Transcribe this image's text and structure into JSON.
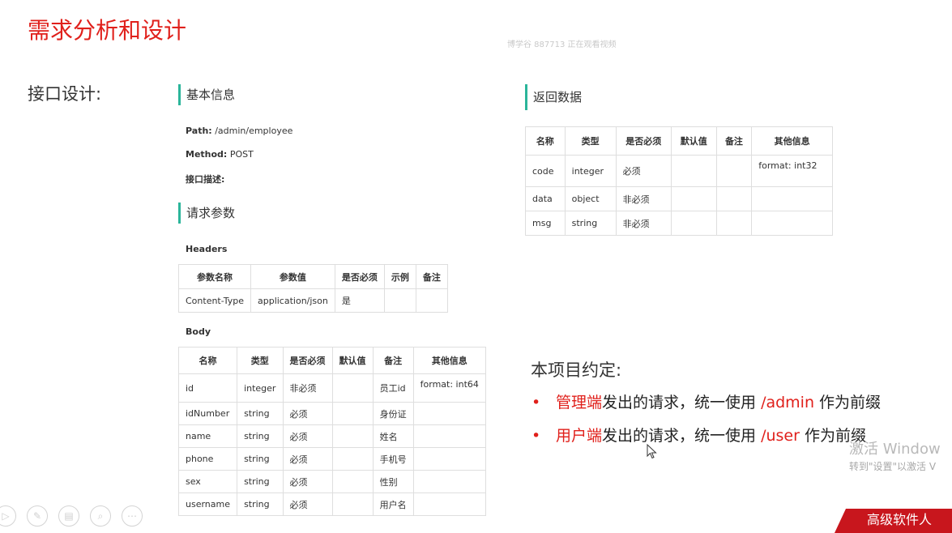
{
  "slide": {
    "title": "需求分析和设计",
    "watermark": "博学谷 887713 正在观看视频",
    "interface_label": "接口设计:"
  },
  "basic_info": {
    "heading": "基本信息",
    "path_label": "Path:",
    "path_value": "/admin/employee",
    "method_label": "Method:",
    "method_value": "POST",
    "desc_label": "接口描述:"
  },
  "request_params": {
    "heading": "请求参数",
    "headers_label": "Headers",
    "headers_columns": [
      "参数名称",
      "参数值",
      "是否必须",
      "示例",
      "备注"
    ],
    "headers_rows": [
      [
        "Content-Type",
        "application/json",
        "是",
        "",
        ""
      ]
    ],
    "body_label": "Body",
    "body_columns": [
      "名称",
      "类型",
      "是否必须",
      "默认值",
      "备注",
      "其他信息"
    ],
    "body_rows": [
      [
        "id",
        "integer",
        "非必须",
        "",
        "员工id",
        "format: int64"
      ],
      [
        "idNumber",
        "string",
        "必须",
        "",
        "身份证",
        ""
      ],
      [
        "name",
        "string",
        "必须",
        "",
        "姓名",
        ""
      ],
      [
        "phone",
        "string",
        "必须",
        "",
        "手机号",
        ""
      ],
      [
        "sex",
        "string",
        "必须",
        "",
        "性别",
        ""
      ],
      [
        "username",
        "string",
        "必须",
        "",
        "用户名",
        ""
      ]
    ]
  },
  "response": {
    "heading": "返回数据",
    "columns": [
      "名称",
      "类型",
      "是否必须",
      "默认值",
      "备注",
      "其他信息"
    ],
    "rows": [
      [
        "code",
        "integer",
        "必须",
        "",
        "",
        "format: int32"
      ],
      [
        "data",
        "object",
        "非必须",
        "",
        "",
        ""
      ],
      [
        "msg",
        "string",
        "非必须",
        "",
        "",
        ""
      ]
    ]
  },
  "convention": {
    "title": "本项目约定:",
    "bullet_char": "•",
    "items": [
      {
        "highlight": "管理端",
        "text_mid": "发出的请求，统一使用 ",
        "path": "/admin",
        "text_end": " 作为前缀"
      },
      {
        "highlight": "用户端",
        "text_mid": "发出的请求，统一使用 ",
        "path": "/user",
        "text_end": " 作为前缀"
      }
    ]
  },
  "overlay": {
    "activate_title": "激活 Window",
    "activate_sub": "转到\"设置\"以激活 V",
    "brand_text": "高级软件人"
  },
  "icons": {
    "play": "play-icon",
    "pen": "pen-icon",
    "pages": "pages-icon",
    "zoom": "zoom-icon",
    "more": "more-icon"
  },
  "colors": {
    "accent_red": "#e0201b",
    "section_bar": "#2bb59a"
  }
}
